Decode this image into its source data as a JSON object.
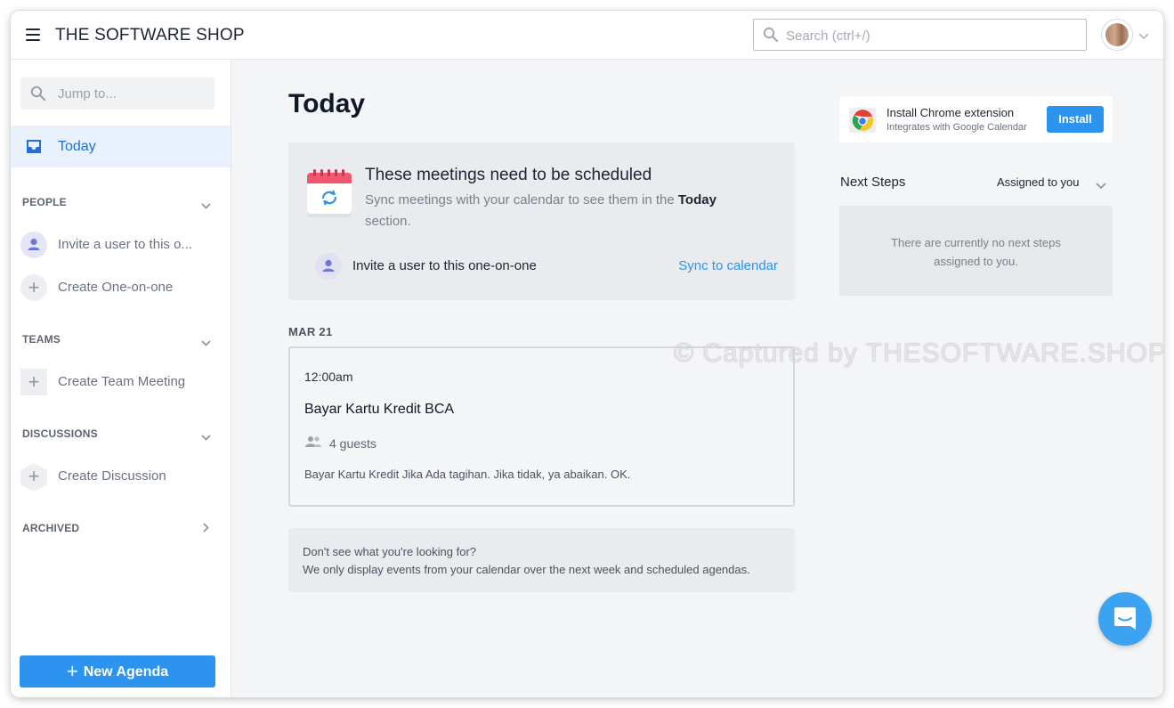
{
  "app": {
    "brand": "THE SOFTWARE SHOP"
  },
  "header": {
    "search_placeholder": "Search (ctrl+/)"
  },
  "sidebar": {
    "jump_placeholder": "Jump to...",
    "today_label": "Today",
    "people": {
      "heading": "PEOPLE",
      "items": [
        {
          "label": "Invite a user to this o..."
        },
        {
          "label": "Create One-on-one"
        }
      ]
    },
    "teams": {
      "heading": "TEAMS",
      "items": [
        {
          "label": "Create Team Meeting"
        }
      ]
    },
    "discussions": {
      "heading": "DISCUSSIONS",
      "items": [
        {
          "label": "Create Discussion"
        }
      ]
    },
    "archived": {
      "heading": "ARCHIVED"
    },
    "new_agenda_label": "New Agenda"
  },
  "main": {
    "title": "Today",
    "schedule_card": {
      "title": "These meetings need to be scheduled",
      "subtitle_prefix": "Sync meetings with your calendar to see them in the ",
      "subtitle_bold": "Today",
      "subtitle_suffix": " section.",
      "invite_label": "Invite a user to this one-on-one",
      "sync_link": "Sync to calendar"
    },
    "date_heading": "MAR 21",
    "event": {
      "time": "12:00am",
      "title": "Bayar Kartu Kredit BCA",
      "guests": "4 guests",
      "description": "Bayar Kartu Kredit Jika Ada tagihan. Jika tidak, ya abaikan. OK."
    },
    "info": {
      "line1": "Don't see what you're looking for?",
      "line2": "We only display events from your calendar over the next week and scheduled agendas."
    }
  },
  "right": {
    "extension": {
      "title": "Install Chrome extension",
      "subtitle": "Integrates with Google Calendar",
      "install_label": "Install"
    },
    "next_steps": {
      "heading": "Next Steps",
      "filter_label": "Assigned to you",
      "empty_line1": "There are currently no next steps",
      "empty_line2": "assigned to you."
    }
  },
  "watermark": "© Captured by THESOFTWARE.SHOP",
  "colors": {
    "accent": "#2c93ee",
    "sidebar_active_bg": "#e9f2fc",
    "calendar_red": "#f1566e"
  }
}
